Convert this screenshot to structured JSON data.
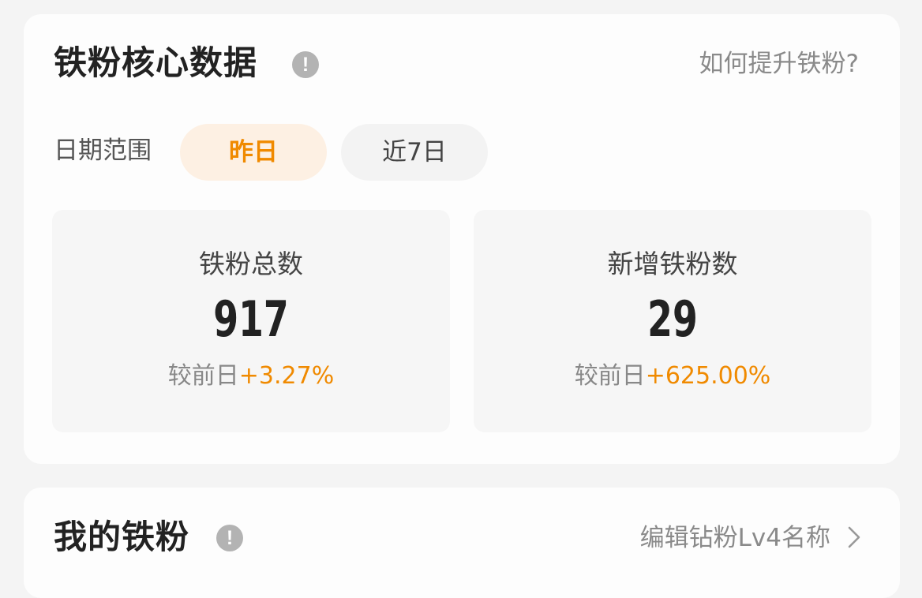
{
  "core": {
    "title": "铁粉核心数据",
    "info_icon": "exclamation-icon",
    "help_link": "如何提升铁粉?",
    "date_range": {
      "label": "日期范围",
      "options": [
        "昨日",
        "近7日"
      ],
      "selected": "昨日"
    },
    "stats": [
      {
        "label": "铁粉总数",
        "value": "917",
        "compare_label": "较前日",
        "compare_value": "+3.27%"
      },
      {
        "label": "新增铁粉数",
        "value": "29",
        "compare_label": "较前日",
        "compare_value": "+625.00%"
      }
    ]
  },
  "mine": {
    "title": "我的铁粉",
    "info_icon": "exclamation-icon",
    "edit_link": "编辑钻粉Lv4名称",
    "chevron_icon": "chevron-right-icon"
  },
  "colors": {
    "accent": "#f08a00",
    "selected_pill_bg": "#fdf0e3",
    "page_bg": "#f4f4f4"
  }
}
